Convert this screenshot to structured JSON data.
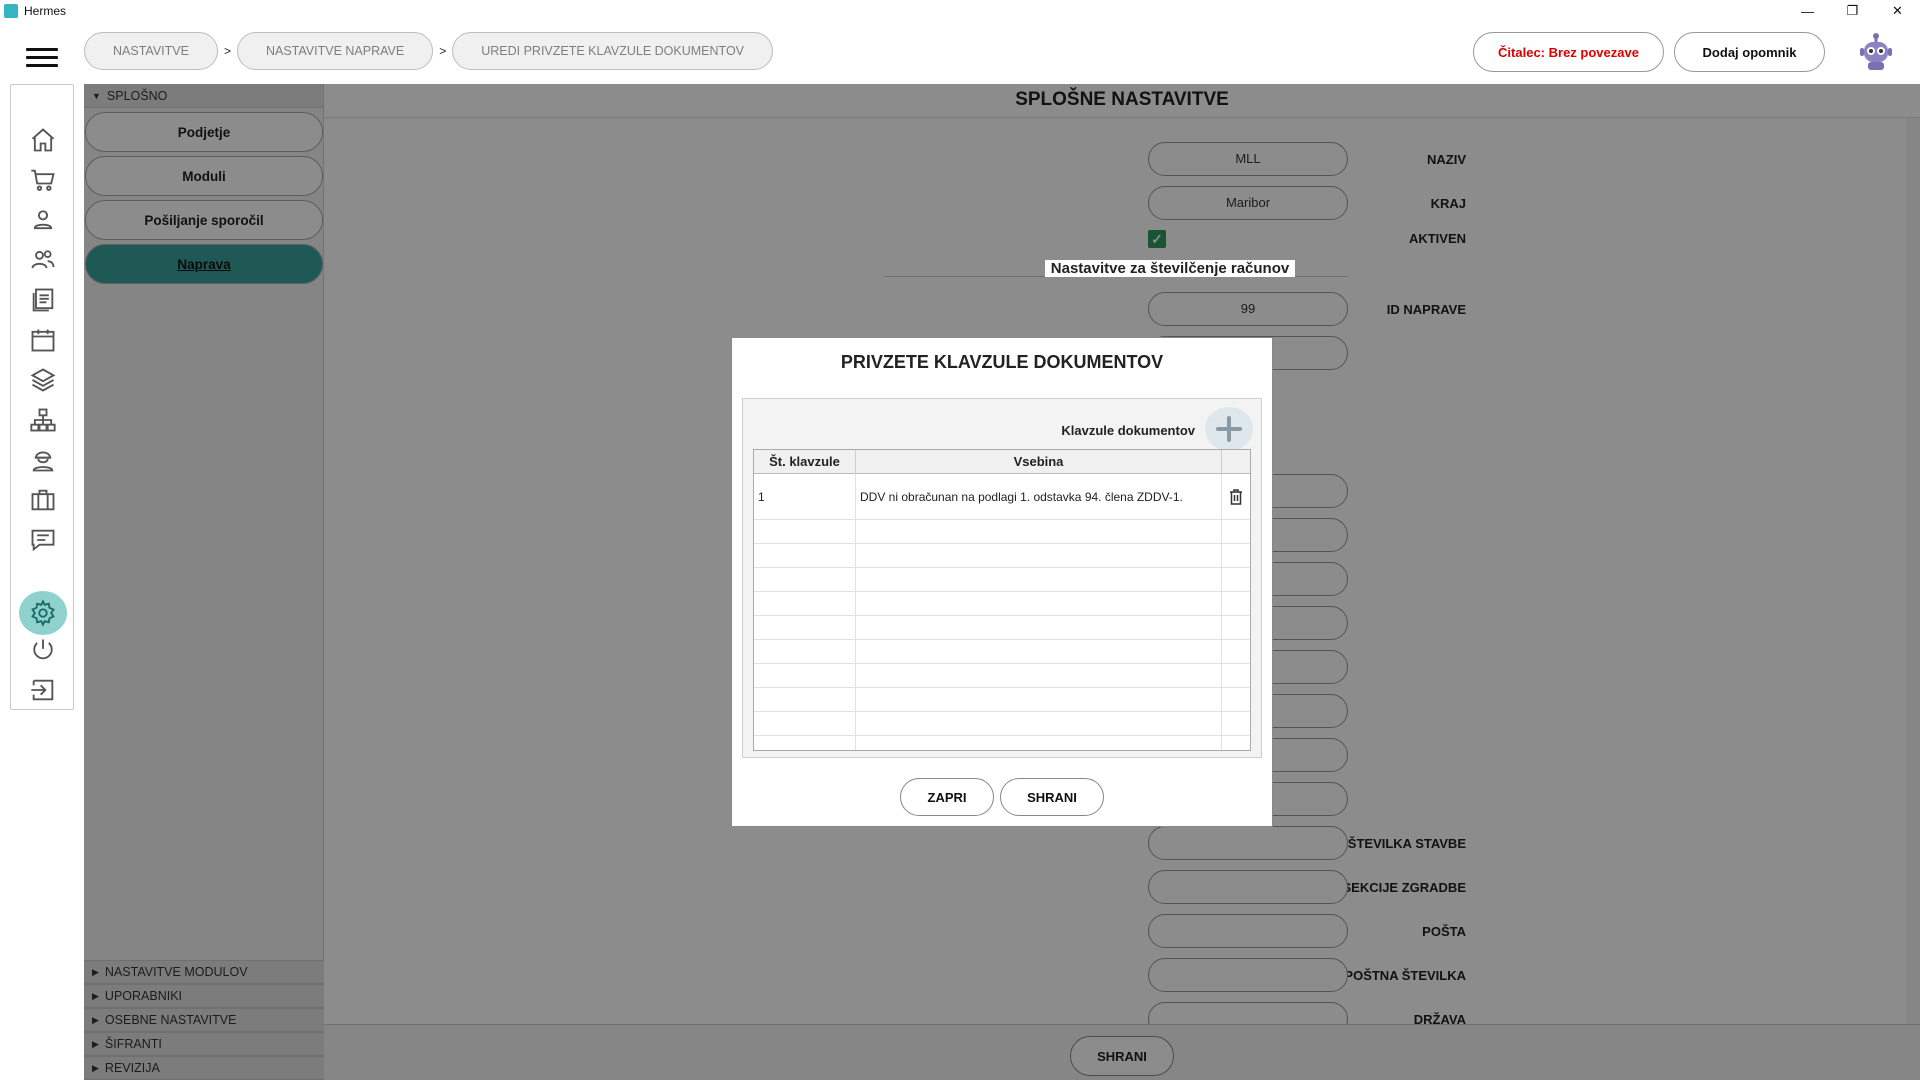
{
  "window": {
    "title": "Hermes",
    "controls": [
      "—",
      "❐",
      "✕"
    ]
  },
  "breadcrumbs": [
    {
      "label": "NASTAVITVE"
    },
    {
      "label": "NASTAVITVE NAPRAVE"
    },
    {
      "label": "UREDI PRIVZETE KLAVZULE DOKUMENTOV"
    }
  ],
  "breadcrumb_sep": ">",
  "header": {
    "reader_label": "Čitalec: Brez povezave",
    "reminder_label": "Dodaj opomnik",
    "reader_color": "#dd0000"
  },
  "rail": {
    "icons": [
      "home-icon",
      "cart-icon",
      "user-icon",
      "users-icon",
      "documents-icon",
      "calendar-icon",
      "layers-icon",
      "network-icon",
      "worker-icon",
      "briefcase-icon",
      "chat-icon",
      "settings-icon",
      "power-icon",
      "logout-icon"
    ],
    "active": "settings-icon"
  },
  "nav": {
    "section": "SPLOŠNO",
    "items": [
      "Podjetje",
      "Moduli",
      "Pošiljanje sporočil",
      "Naprava"
    ],
    "active_item": "Naprava",
    "bottom_sections": [
      "NASTAVITVE MODULOV",
      "UPORABNIKI",
      "OSEBNE NASTAVITVE",
      "ŠIFRANTI",
      "REVIZIJA"
    ]
  },
  "main": {
    "title": "SPLOŠNE NASTAVITVE",
    "naziv_label": "NAZIV",
    "naziv_value": "MLL",
    "kraj_label": "KRAJ",
    "kraj_value": "Maribor",
    "aktiven_label": "AKTIVEN",
    "aktiven_checked": "✓",
    "section_title": "Nastavitve za številčenje računov",
    "id_label": "ID NAPRAVE",
    "id_value": "99",
    "stavbe_label": "ŠTEVILKA STAVBE",
    "sekcije_label": "ŠTEVILKA SEKCIJE ZGRADBE",
    "posta_label": "POŠTA",
    "postna_label": "POŠTNA ŠTEVILKA",
    "drzava_label": "DRŽAVA",
    "save_label": "SHRANI"
  },
  "modal": {
    "title": "PRIVZETE KLAVZULE DOKUMENTOV",
    "panel_label": "Klavzule dokumentov",
    "columns": [
      "Št. klavzule",
      "Vsebina"
    ],
    "rows": [
      {
        "num": "1",
        "content": "DDV ni obračunan na podlagi 1. odstavka 94. člena ZDDV-1."
      }
    ],
    "close_label": "ZAPRI",
    "save_label": "SHRANI"
  },
  "colors": {
    "accent": "#3aa39c",
    "rail_active": "#8fd1cd",
    "check": "#2e9a5c"
  }
}
